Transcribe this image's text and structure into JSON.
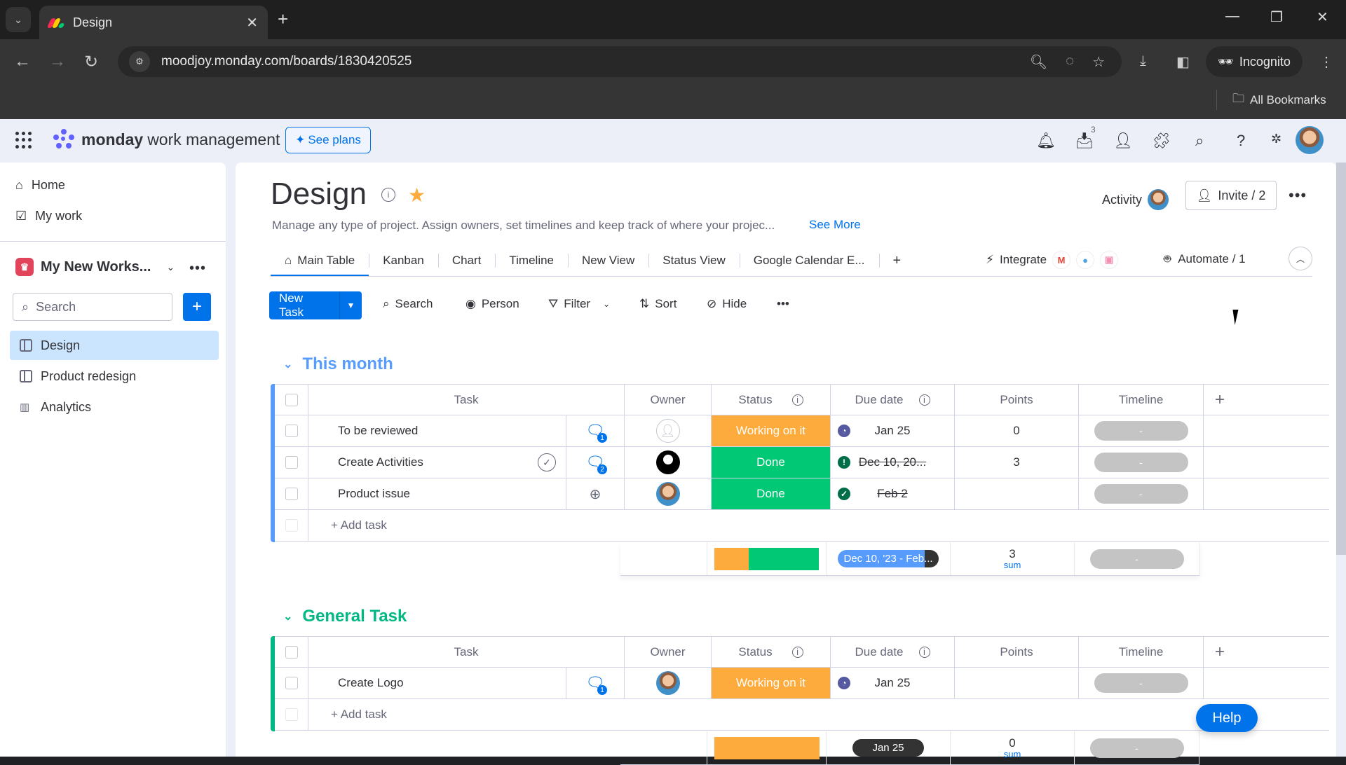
{
  "browser": {
    "tab_title": "Design",
    "url": "moodjoy.monday.com/boards/1830420525",
    "incognito_label": "Incognito",
    "bookmarks_label": "All Bookmarks"
  },
  "app_header": {
    "brand_bold": "monday",
    "brand_rest": "work management",
    "see_plans": "See plans",
    "inbox_count": "3"
  },
  "sidebar": {
    "home": "Home",
    "my_work": "My work",
    "workspace": "My New Works...",
    "search_placeholder": "Search",
    "boards": [
      {
        "label": "Design",
        "active": true
      },
      {
        "label": "Product redesign",
        "active": false
      },
      {
        "label": "Analytics",
        "active": false
      }
    ]
  },
  "board": {
    "title": "Design",
    "description": "Manage any type of project. Assign owners, set timelines and keep track of where your projec...",
    "see_more": "See More",
    "activity": "Activity",
    "invite": "Invite / 2",
    "views": [
      "Main Table",
      "Kanban",
      "Chart",
      "Timeline",
      "New View",
      "Status View",
      "Google Calendar E..."
    ],
    "integrate": "Integrate",
    "automate": "Automate / 1"
  },
  "toolbar": {
    "new_task": "New Task",
    "search": "Search",
    "person": "Person",
    "filter": "Filter",
    "sort": "Sort",
    "hide": "Hide"
  },
  "columns": [
    "Task",
    "Owner",
    "Status",
    "Due date",
    "Points",
    "Timeline"
  ],
  "colors": {
    "working": "#fdab3d",
    "done": "#00c875",
    "done_dark": "#00a86b",
    "primary": "#0073ea",
    "group1": "#579bfc",
    "group2": "#00b884"
  },
  "groups": [
    {
      "title": "This month",
      "rows": [
        {
          "task": "To be reviewed",
          "comments": "1",
          "owner": "empty",
          "status": "Working on it",
          "due": "Jan 25",
          "due_icon": "clock",
          "points": "0",
          "timeline": "-"
        },
        {
          "task": "Create Activities",
          "comments": "2",
          "owner": "black",
          "status": "Done",
          "due": "Dec 10, 20...",
          "due_icon": "alert",
          "points": "3",
          "timeline": "-"
        },
        {
          "task": "Product issue",
          "comments": "",
          "owner": "avatar",
          "status": "Done",
          "due": "Feb 2",
          "due_icon": "check",
          "points": "",
          "timeline": "-"
        }
      ],
      "add_task": "+ Add task",
      "summary": {
        "status_working_fraction": 0.333,
        "due_range": "Dec 10, '23 - Feb...",
        "points": "3",
        "points_label": "sum",
        "timeline": "-"
      }
    },
    {
      "title": "General Task",
      "rows": [
        {
          "task": "Create Logo",
          "comments": "1",
          "owner": "avatar",
          "status": "Working on it",
          "due": "Jan 25",
          "due_icon": "clock",
          "points": "",
          "timeline": "-"
        }
      ],
      "add_task": "+ Add task",
      "summary": {
        "due_range": "Jan 25",
        "points": "0",
        "points_label": "sum",
        "timeline": "-"
      }
    }
  ],
  "help": "Help"
}
